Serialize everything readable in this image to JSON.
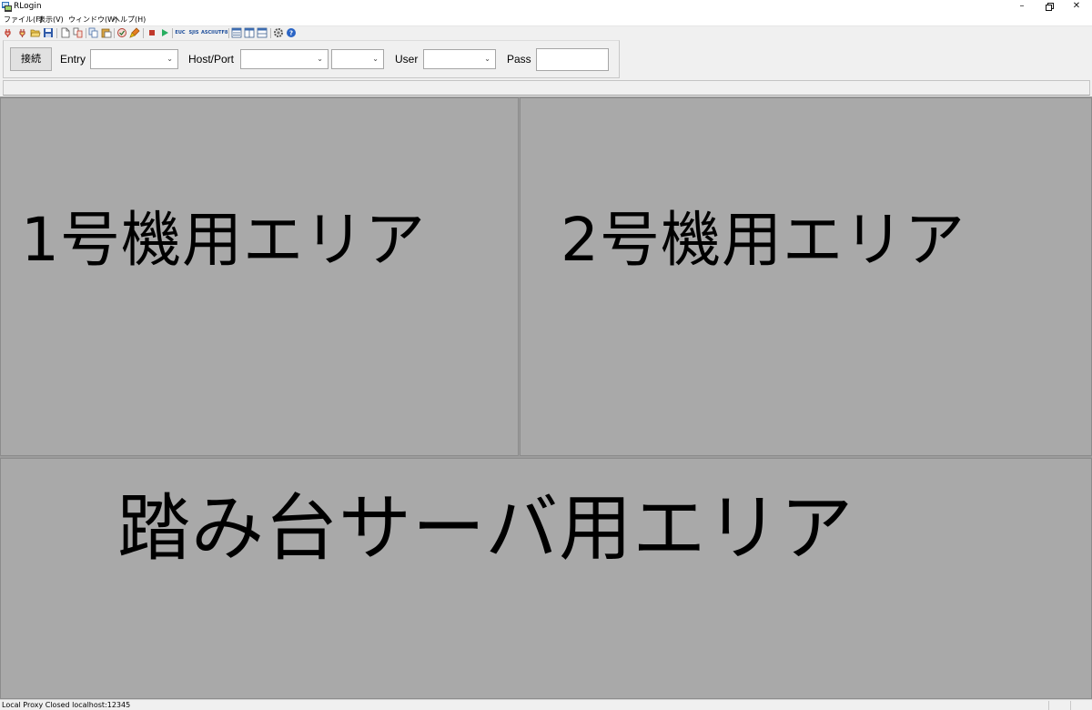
{
  "window": {
    "title": "RLogin",
    "minimize_icon": "minimize-icon",
    "maximize_icon": "restore-icon",
    "close_icon": "close-icon"
  },
  "menu": {
    "items": [
      "ファイル(F)",
      "表示(V)",
      "ウィンドウ(W)",
      "ヘルプ(H)"
    ]
  },
  "toolbar": {
    "encoding_buttons": [
      "EUC",
      "SJIS",
      "ASCII",
      "UTF8"
    ]
  },
  "connection": {
    "connect_label": "接続",
    "entry_label": "Entry",
    "entry_value": "",
    "host_port_label": "Host/Port",
    "host_value": "",
    "port_value": "",
    "user_label": "User",
    "user_value": "",
    "pass_label": "Pass",
    "pass_value": ""
  },
  "panes": [
    {
      "label": "1号機用エリア"
    },
    {
      "label": "2号機用エリア"
    },
    {
      "label": "踏み台サーバ用エリア"
    }
  ],
  "status": {
    "text": "Local Proxy Closed localhost:12345"
  },
  "colors": {
    "pane_background": "#a9a9a9",
    "window_background": "#f0f0f0",
    "encoding_text": "#1b4c9a"
  }
}
